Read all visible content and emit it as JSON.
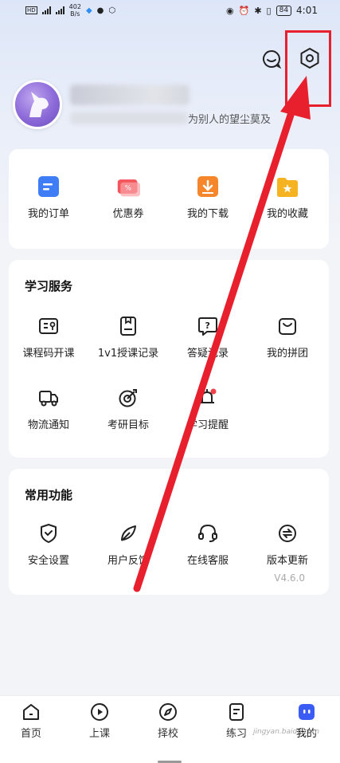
{
  "status_bar": {
    "network_speed": "402",
    "network_unit": "B/s",
    "battery": "84",
    "time": "4:01"
  },
  "header": {
    "motto": "为别人的望尘莫及"
  },
  "orders_card": {
    "items": [
      {
        "label": "我的订单",
        "icon": "order-icon",
        "color": "#3f7df6"
      },
      {
        "label": "优惠券",
        "icon": "coupon-icon",
        "color": "#f2555a"
      },
      {
        "label": "我的下载",
        "icon": "download-icon",
        "color": "#f5862b"
      },
      {
        "label": "我的收藏",
        "icon": "favorite-folder-icon",
        "color": "#f5b321"
      }
    ]
  },
  "study_services": {
    "title": "学习服务",
    "items": [
      {
        "label": "课程码开课",
        "icon": "course-code-icon"
      },
      {
        "label": "1v1授课记录",
        "icon": "lesson-record-icon"
      },
      {
        "label": "答疑记录",
        "icon": "qa-record-icon"
      },
      {
        "label": "我的拼团",
        "icon": "group-buy-icon"
      },
      {
        "label": "物流通知",
        "icon": "logistics-truck-icon"
      },
      {
        "label": "考研目标",
        "icon": "target-icon"
      },
      {
        "label": "学习提醒",
        "icon": "reminder-bell-icon"
      }
    ]
  },
  "common_functions": {
    "title": "常用功能",
    "items": [
      {
        "label": "安全设置",
        "icon": "security-shield-icon"
      },
      {
        "label": "用户反馈",
        "icon": "feedback-leaf-icon"
      },
      {
        "label": "在线客服",
        "icon": "headset-icon"
      },
      {
        "label": "版本更新",
        "icon": "update-icon"
      }
    ],
    "version": "V4.6.0"
  },
  "bottom_nav": {
    "items": [
      {
        "label": "首页",
        "icon": "home-icon"
      },
      {
        "label": "上课",
        "icon": "play-icon"
      },
      {
        "label": "择校",
        "icon": "compass-icon"
      },
      {
        "label": "练习",
        "icon": "practice-doc-icon"
      },
      {
        "label": "我的",
        "icon": "profile-mascot-icon",
        "active": true
      }
    ],
    "accent_color": "#3b5bf5"
  },
  "watermark": "jingyan.baidu.com",
  "annotation_color": "#e8202e"
}
